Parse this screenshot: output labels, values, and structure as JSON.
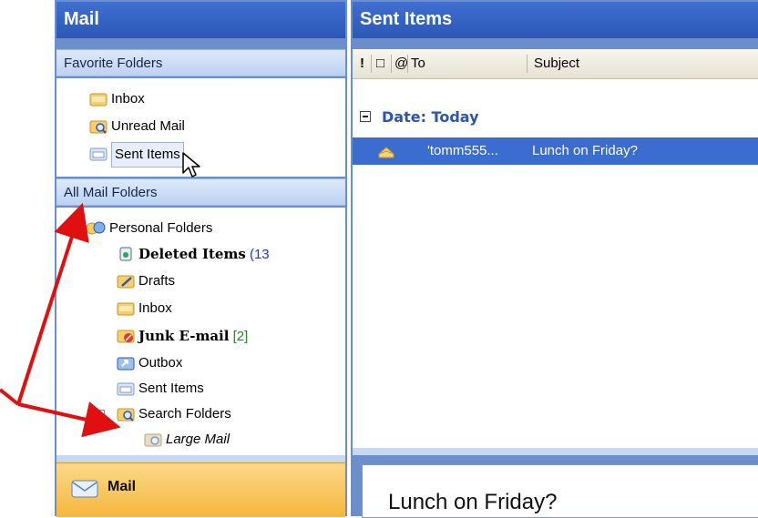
{
  "nav": {
    "title": "Mail",
    "favorites_header": "Favorite Folders",
    "favorites": [
      {
        "label": "Inbox"
      },
      {
        "label": "Unread Mail"
      },
      {
        "label": "Sent Items"
      }
    ],
    "all_header": "All Mail Folders",
    "tree": {
      "root": "Personal Folders",
      "items": [
        {
          "label": "Deleted Items",
          "count": "(13"
        },
        {
          "label": "Drafts"
        },
        {
          "label": "Inbox"
        },
        {
          "label": "Junk E-mail",
          "count": "[2]"
        },
        {
          "label": "Outbox"
        },
        {
          "label": "Sent Items"
        },
        {
          "label": "Search Folders"
        },
        {
          "label": "Large Mail"
        }
      ]
    },
    "mail_button": "Mail"
  },
  "reading": {
    "title": "Sent Items",
    "columns": {
      "importance": "!",
      "icon": "□",
      "attachment": "@",
      "to": "To",
      "subject": "Subject"
    },
    "group_label": "Date: Today",
    "message": {
      "to": "'tomm555...",
      "subject": "Lunch on Friday?"
    },
    "preview_subject": "Lunch on Friday?"
  },
  "colors": {
    "accent": "#2b58b6",
    "selection": "#3b6dd0",
    "annotation_arrow": "#e01010"
  }
}
